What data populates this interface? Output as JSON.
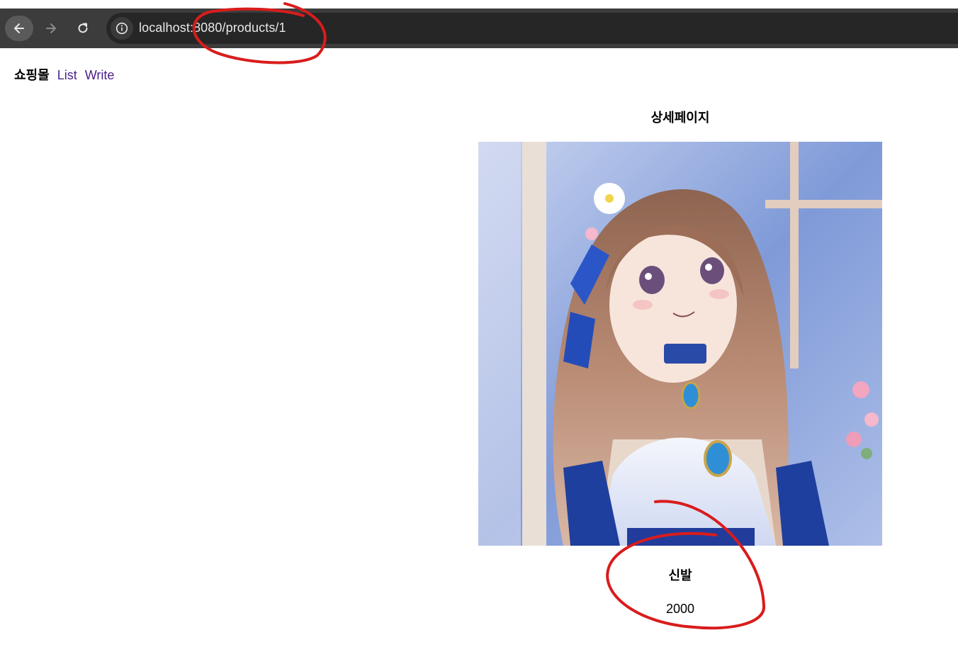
{
  "browser": {
    "url_host": "localhost:",
    "url_path": "8080/products/1",
    "icons": [
      "back-arrow-icon",
      "forward-arrow-icon",
      "reload-icon",
      "info-icon"
    ]
  },
  "nav": {
    "brand": "쇼핑몰",
    "links": [
      "List",
      "Write"
    ]
  },
  "page": {
    "title": "상세페이지"
  },
  "product": {
    "image_alt": "watercolor anime girl illustration with long hair, flower in hair, blue dress",
    "name": "신발",
    "price": "2000"
  },
  "colors": {
    "annotation": "#d91c1c",
    "link": "#4b1e8a",
    "browser_bar": "#3c3c3c"
  }
}
